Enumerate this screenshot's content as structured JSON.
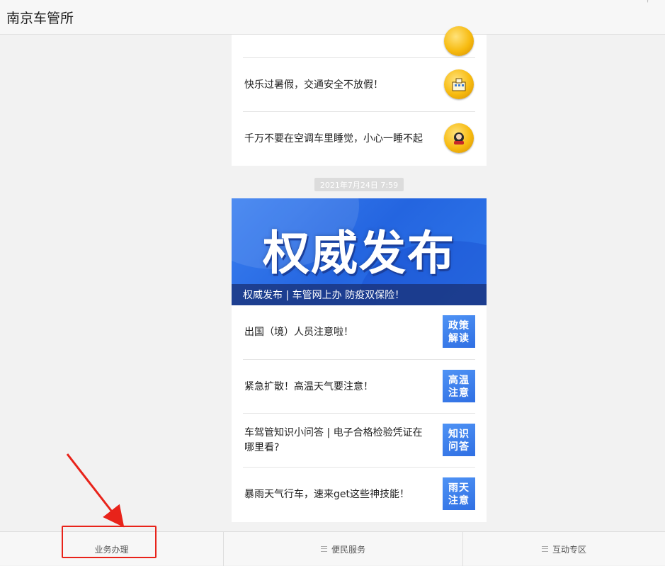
{
  "window": {
    "title": "南京车管所"
  },
  "feed": {
    "card1": {
      "items": [
        {
          "text": "快乐过暑假，交通安全不放假！",
          "icon": "building-coin-icon"
        },
        {
          "text": "千万不要在空调车里睡觉，小心一睡不起",
          "icon": "car-coin-icon"
        }
      ]
    },
    "timestamp": "2021年7月24日 7:59",
    "card2": {
      "banner_title": "权威发布",
      "banner_caption": "权威发布 | 车管网上办 防疫双保险！",
      "items": [
        {
          "text": "出国（境）人员注意啦！",
          "tile": "政策解读"
        },
        {
          "text": "紧急扩散！高温天气要注意！",
          "tile": "高温注意"
        },
        {
          "text": "车驾管知识小问答 | 电子合格检验凭证在哪里看?",
          "tile": "知识问答"
        },
        {
          "text": "暴雨天气行车，速来get这些神技能！",
          "tile": "雨天注意"
        }
      ]
    }
  },
  "bottom_menu": {
    "tabs": [
      {
        "label": "业务办理",
        "has_menu_icon": false
      },
      {
        "label": "便民服务",
        "has_menu_icon": true
      },
      {
        "label": "互动专区",
        "has_menu_icon": true
      }
    ]
  },
  "colors": {
    "annotation": "#e8231a",
    "accent_blue": "#2f6fe3",
    "coin": "#f7bb10"
  }
}
